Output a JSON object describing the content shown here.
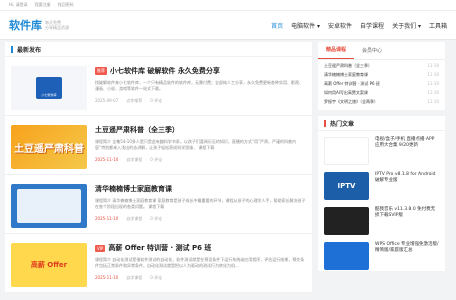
{
  "topbar": {
    "hi": "Hi, 请登录",
    "register": "我要注册",
    "forgot": "找回密码"
  },
  "logo": {
    "name": "软件库",
    "tag1": "每天免费",
    "tag2": "分享精品资源"
  },
  "nav": [
    "首页",
    "电脑软件 ▾",
    "安卓软件",
    "自学课程",
    "关于我们 ▾",
    "工具箱"
  ],
  "main": {
    "section_title": "最新发布",
    "posts": [
      {
        "badge": "推荐",
        "title": "小七软件库 破解软件 永久免费分享",
        "desc": "找破解软件来小七软件库，一个只有精品软件的软件库，无需付费；全部纯人工分享，永久免费更新各种实用、影视、漫画、小说、游戏等软件一站式下载。",
        "date": "2025-09-07",
        "cat": "点作推荐",
        "comments": "0 评论",
        "thumb": "小七软件库",
        "red": false
      },
      {
        "badge": "",
        "title": "土豆遥严肃科普（全三季）",
        "desc": "课程简介 全集54-10多人是只是此有趣科学书条，以孩子们喜闻乐见的知识，直播的方式“用”严肃，严谨的科普内容”特别都来入浅出的去讲解，让孩子轻松养成科学思维、 课程下载",
        "date": "2025-11-10",
        "cat": "自学课程",
        "comments": "0 评论",
        "thumb": "土豆遥严肃科普",
        "red": true
      },
      {
        "badge": "",
        "title": "清华楠楠博士家庭教育课",
        "desc": "课程简介 清华楠楠博士家庭教育课 家庭教育是孩子成长中最重要的环节，课程从孩子的心理学人手，帮助家长解决孩子在各个阶段出现的各类问题。 课程下载",
        "date": "2025-11-10",
        "cat": "自学课程",
        "comments": "0 评论",
        "thumb": "",
        "red": true
      },
      {
        "badge": "VIP",
        "title": "高薪 Offer 特训营 · 测试 P6 班",
        "desc": "课程简介 自动化测试是指软件测试的自动化，软件测试就是在预设条件下运行系统或应用程序，评估运行结果，预先条件包括正常条件和异常条件。自动化测试就是把以人为驱动的测试行为转化为机...",
        "date": "2025-11-10",
        "cat": "自学课程",
        "comments": "0 评论",
        "thumb": "高薪 Offer",
        "red": true
      }
    ]
  },
  "side": {
    "tabs": [
      "精品课程",
      "会员中心"
    ],
    "list": [
      {
        "text": "土豆遥严肃科普（全三季）",
        "date": "11-10"
      },
      {
        "text": "清华楠楠博士家庭教育课",
        "date": "11-10"
      },
      {
        "text": "高薪 Offer 特训营 · 测试 P6 班",
        "date": "11-10"
      },
      {
        "text": "如何用AI写出高赞文案课",
        "date": "11-10"
      },
      {
        "text": "罗振宇《文明之旅》（全两季）",
        "date": "11-10"
      }
    ],
    "hot_title": "热门文章",
    "hot": [
      {
        "text": "电视/盒子/手机 直播点播 APP 应用大合集 9/20更新",
        "meta": "",
        "thumb": ""
      },
      {
        "text": "IPTV Pro v8.1.8 for Android 破解专业版",
        "meta": "",
        "thumb": "IPTV"
      },
      {
        "text": "酷我音乐 v11.3.8.0 免付费无损下载SVIP版",
        "meta": "",
        "thumb": ""
      },
      {
        "text": "WPS Office 专业增强免激活版/精简版/家庭版汇总",
        "meta": "",
        "thumb": ""
      }
    ]
  }
}
